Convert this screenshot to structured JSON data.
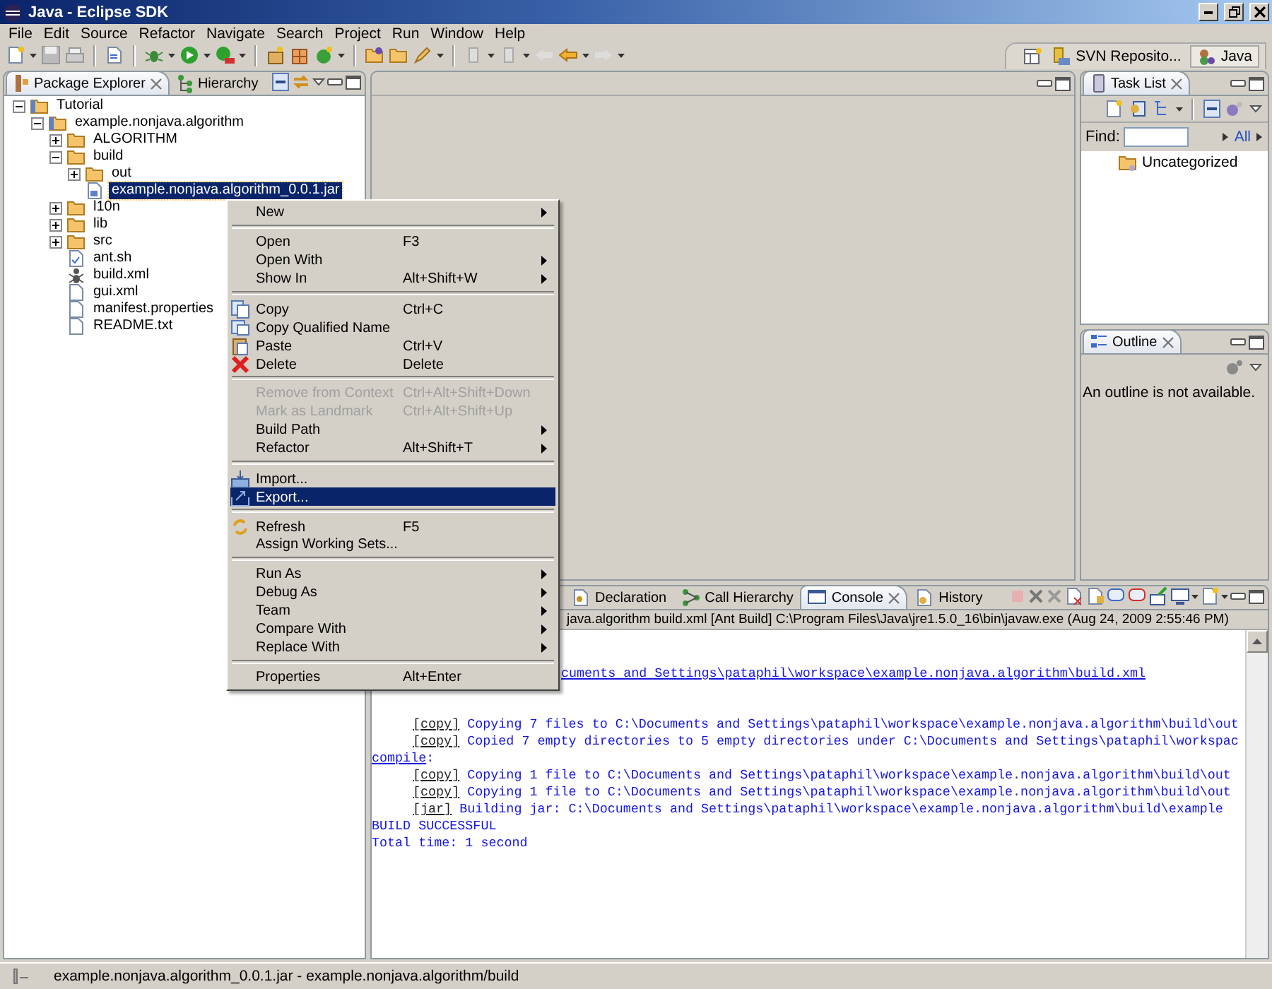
{
  "window": {
    "title": "Java - Eclipse SDK"
  },
  "menu_bar": [
    "File",
    "Edit",
    "Source",
    "Refactor",
    "Navigate",
    "Search",
    "Project",
    "Run",
    "Window",
    "Help"
  ],
  "perspectives": [
    {
      "label": "SVN Reposito...",
      "selected": false
    },
    {
      "label": "Java",
      "selected": true
    }
  ],
  "package_explorer": {
    "tabs": [
      {
        "label": "Package Explorer",
        "selected": true
      },
      {
        "label": "Hierarchy",
        "selected": false
      }
    ],
    "tree": [
      {
        "label": "Tutorial",
        "kind": "project",
        "expanded": true,
        "selected": false,
        "children": [
          {
            "label": "example.nonjava.algorithm",
            "kind": "project",
            "expanded": true,
            "selected": false,
            "children": [
              {
                "label": "ALGORITHM",
                "kind": "folder",
                "expanded": false,
                "selected": false
              },
              {
                "label": "build",
                "kind": "folder",
                "expanded": true,
                "selected": false,
                "children": [
                  {
                    "label": "out",
                    "kind": "folder",
                    "expanded": false,
                    "selected": false
                  },
                  {
                    "label": "example.nonjava.algorithm_0.0.1.jar",
                    "kind": "archive",
                    "selected": true
                  }
                ]
              },
              {
                "label": "l10n",
                "kind": "folder",
                "expanded": false,
                "selected": false
              },
              {
                "label": "lib",
                "kind": "folder",
                "expanded": false,
                "selected": false
              },
              {
                "label": "src",
                "kind": "folder",
                "expanded": false,
                "selected": false
              },
              {
                "label": "ant.sh",
                "kind": "script",
                "selected": false
              },
              {
                "label": "build.xml",
                "kind": "ant",
                "selected": false
              },
              {
                "label": "gui.xml",
                "kind": "file",
                "selected": false
              },
              {
                "label": "manifest.properties",
                "kind": "file",
                "selected": false
              },
              {
                "label": "README.txt",
                "kind": "file",
                "selected": false
              }
            ]
          }
        ]
      }
    ]
  },
  "context_menu": [
    {
      "kind": "item",
      "label": "New",
      "submenu": true,
      "disabled": false,
      "selected": false
    },
    {
      "kind": "separator"
    },
    {
      "kind": "item",
      "label": "Open",
      "shortcut": "F3",
      "submenu": false,
      "disabled": false,
      "selected": false
    },
    {
      "kind": "item",
      "label": "Open With",
      "submenu": true,
      "disabled": false,
      "selected": false
    },
    {
      "kind": "item",
      "label": "Show In",
      "shortcut": "Alt+Shift+W",
      "submenu": true,
      "disabled": false,
      "selected": false
    },
    {
      "kind": "separator"
    },
    {
      "kind": "item",
      "label": "Copy",
      "shortcut": "Ctrl+C",
      "submenu": false,
      "disabled": false,
      "selected": false
    },
    {
      "kind": "item",
      "label": "Copy Qualified Name",
      "submenu": false,
      "disabled": false,
      "selected": false
    },
    {
      "kind": "item",
      "label": "Paste",
      "shortcut": "Ctrl+V",
      "submenu": false,
      "disabled": false,
      "selected": false
    },
    {
      "kind": "item",
      "label": "Delete",
      "shortcut": "Delete",
      "submenu": false,
      "disabled": false,
      "selected": false
    },
    {
      "kind": "separator"
    },
    {
      "kind": "item",
      "label": "Remove from Context",
      "shortcut": "Ctrl+Alt+Shift+Down",
      "submenu": false,
      "disabled": true,
      "selected": false
    },
    {
      "kind": "item",
      "label": "Mark as Landmark",
      "shortcut": "Ctrl+Alt+Shift+Up",
      "submenu": false,
      "disabled": true,
      "selected": false
    },
    {
      "kind": "item",
      "label": "Build Path",
      "submenu": true,
      "disabled": false,
      "selected": false
    },
    {
      "kind": "item",
      "label": "Refactor",
      "shortcut": "Alt+Shift+T",
      "submenu": true,
      "disabled": false,
      "selected": false
    },
    {
      "kind": "separator"
    },
    {
      "kind": "item",
      "label": "Import...",
      "submenu": false,
      "disabled": false,
      "selected": false
    },
    {
      "kind": "item",
      "label": "Export...",
      "submenu": false,
      "disabled": false,
      "selected": true
    },
    {
      "kind": "separator"
    },
    {
      "kind": "item",
      "label": "Refresh",
      "shortcut": "F5",
      "submenu": false,
      "disabled": false,
      "selected": false
    },
    {
      "kind": "item",
      "label": "Assign Working Sets...",
      "submenu": false,
      "disabled": false,
      "selected": false
    },
    {
      "kind": "separator"
    },
    {
      "kind": "item",
      "label": "Run As",
      "submenu": true,
      "disabled": false,
      "selected": false
    },
    {
      "kind": "item",
      "label": "Debug As",
      "submenu": true,
      "disabled": false,
      "selected": false
    },
    {
      "kind": "item",
      "label": "Team",
      "submenu": true,
      "disabled": false,
      "selected": false
    },
    {
      "kind": "item",
      "label": "Compare With",
      "submenu": true,
      "disabled": false,
      "selected": false
    },
    {
      "kind": "item",
      "label": "Replace With",
      "submenu": true,
      "disabled": false,
      "selected": false
    },
    {
      "kind": "separator"
    },
    {
      "kind": "item",
      "label": "Properties",
      "shortcut": "Alt+Enter",
      "submenu": false,
      "disabled": false,
      "selected": false
    }
  ],
  "console": {
    "tabs": [
      {
        "label": "Declaration",
        "selected": false
      },
      {
        "label": "Call Hierarchy",
        "selected": false
      },
      {
        "label": "Console",
        "selected": true
      },
      {
        "label": "History",
        "selected": false
      }
    ],
    "header": "java.algorithm build.xml [Ant Build] C:\\Program Files\\Java\\jre1.5.0_16\\bin\\javaw.exe (Aug 24, 2009 2:55:46 PM)",
    "lines": [
      {
        "kind": "cut",
        "text": "cuments and Settings\\pataphil\\workspace\\example.nonjava.algorithm\\build.xml"
      },
      {
        "kind": "gap"
      },
      {
        "kind": "gap"
      },
      {
        "kind": "task",
        "task": "[copy]",
        "text": "Copying 7 files to C:\\Documents and Settings\\pataphil\\workspace\\example.nonjava.algorithm\\build\\out"
      },
      {
        "kind": "task",
        "task": "[copy]",
        "text": "Copied 7 empty directories to 5 empty directories under C:\\Documents and Settings\\pataphil\\workspac"
      },
      {
        "kind": "target",
        "target": "compile",
        "text": ":"
      },
      {
        "kind": "task",
        "task": "[copy]",
        "text": "Copying 1 file to C:\\Documents and Settings\\pataphil\\workspace\\example.nonjava.algorithm\\build\\out"
      },
      {
        "kind": "task",
        "task": "[copy]",
        "text": "Copying 1 file to C:\\Documents and Settings\\pataphil\\workspace\\example.nonjava.algorithm\\build\\out"
      },
      {
        "kind": "task",
        "task": "[jar]",
        "text": "Building jar: C:\\Documents and Settings\\pataphil\\workspace\\example.nonjava.algorithm\\build\\example"
      },
      {
        "kind": "plain",
        "text": "BUILD SUCCESSFUL"
      },
      {
        "kind": "plain",
        "text": "Total time: 1 second"
      }
    ]
  },
  "task_list": {
    "tab": "Task List",
    "find_label": "Find:",
    "filter": "All",
    "category": "Uncategorized"
  },
  "outline": {
    "tab": "Outline",
    "message": "An outline is not available."
  },
  "status_bar": "example.nonjava.algorithm_0.0.1.jar - example.nonjava.algorithm/build"
}
